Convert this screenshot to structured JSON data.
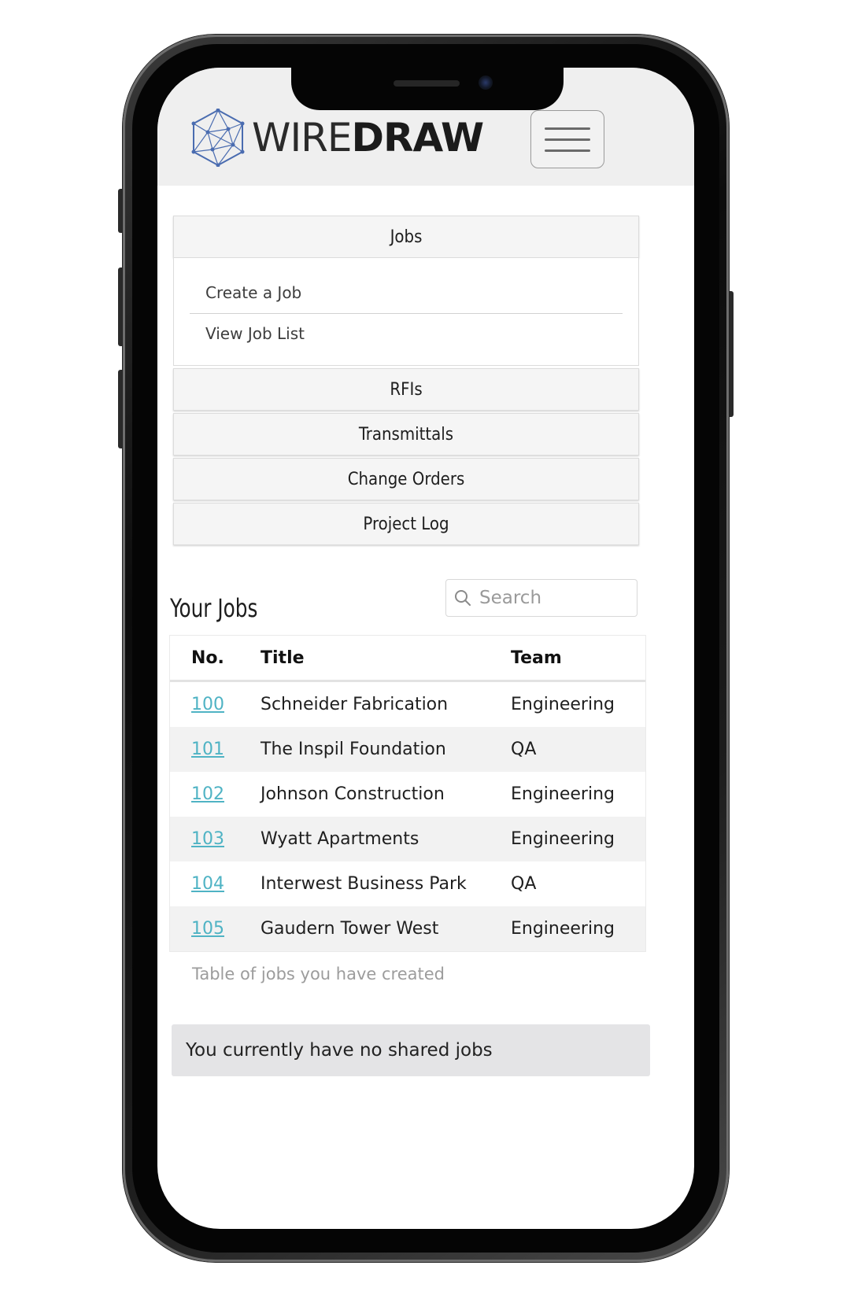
{
  "header": {
    "logo_light": "WIRE",
    "logo_bold": "DRAW",
    "menu_icon": "hamburger-menu-icon"
  },
  "nav": {
    "jobs": {
      "label": "Jobs",
      "links": [
        "Create a Job",
        "View Job List"
      ]
    },
    "sections": [
      "RFIs",
      "Transmittals",
      "Change Orders",
      "Project Log"
    ]
  },
  "jobs": {
    "title": "Your Jobs",
    "search_placeholder": "Search",
    "search_icon": "search-icon",
    "columns": [
      "No.",
      "Title",
      "Team"
    ],
    "rows": [
      {
        "no": "100",
        "title": "Schneider Fabrication",
        "team": "Engineering"
      },
      {
        "no": "101",
        "title": "The Inspil Foundation",
        "team": "QA"
      },
      {
        "no": "102",
        "title": "Johnson Construction",
        "team": "Engineering"
      },
      {
        "no": "103",
        "title": "Wyatt Apartments",
        "team": "Engineering"
      },
      {
        "no": "104",
        "title": "Interwest Business Park",
        "team": "QA"
      },
      {
        "no": "105",
        "title": "Gaudern Tower West",
        "team": "Engineering"
      }
    ],
    "caption": "Table of jobs you have created"
  },
  "shared": {
    "message": "You currently have no shared jobs"
  },
  "colors": {
    "link": "#4fb3c4",
    "header_bg": "#efefef",
    "logo_mesh": "#4a6cb0"
  }
}
